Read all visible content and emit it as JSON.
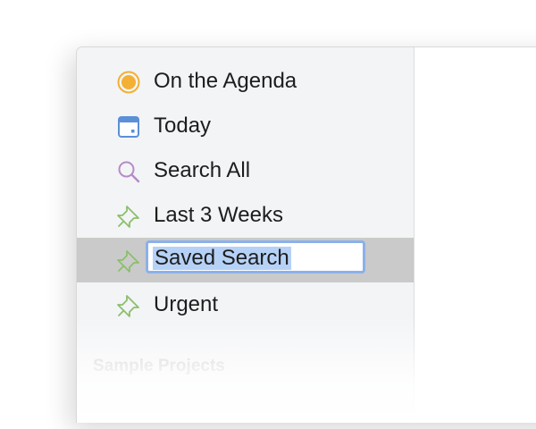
{
  "sidebar": {
    "items": [
      {
        "label": "On the Agenda",
        "icon": "agenda-dot-icon",
        "color": "#f2b035"
      },
      {
        "label": "Today",
        "icon": "calendar-icon",
        "color": "#5b8fd8"
      },
      {
        "label": "Search All",
        "icon": "search-icon",
        "color": "#b58ac9"
      },
      {
        "label": "Last 3 Weeks",
        "icon": "pin-icon",
        "color": "#8bbf6c"
      },
      {
        "label": "Saved Search",
        "icon": "pin-icon",
        "color": "#8bbf6c",
        "selected": true,
        "editing": true
      },
      {
        "label": "Urgent",
        "icon": "pin-icon",
        "color": "#8bbf6c"
      }
    ],
    "section_header": "Sample Projects"
  },
  "colors": {
    "selection_bg": "#cacaca",
    "edit_border": "#8bb1ea",
    "text_highlight": "#b6d1f6"
  }
}
